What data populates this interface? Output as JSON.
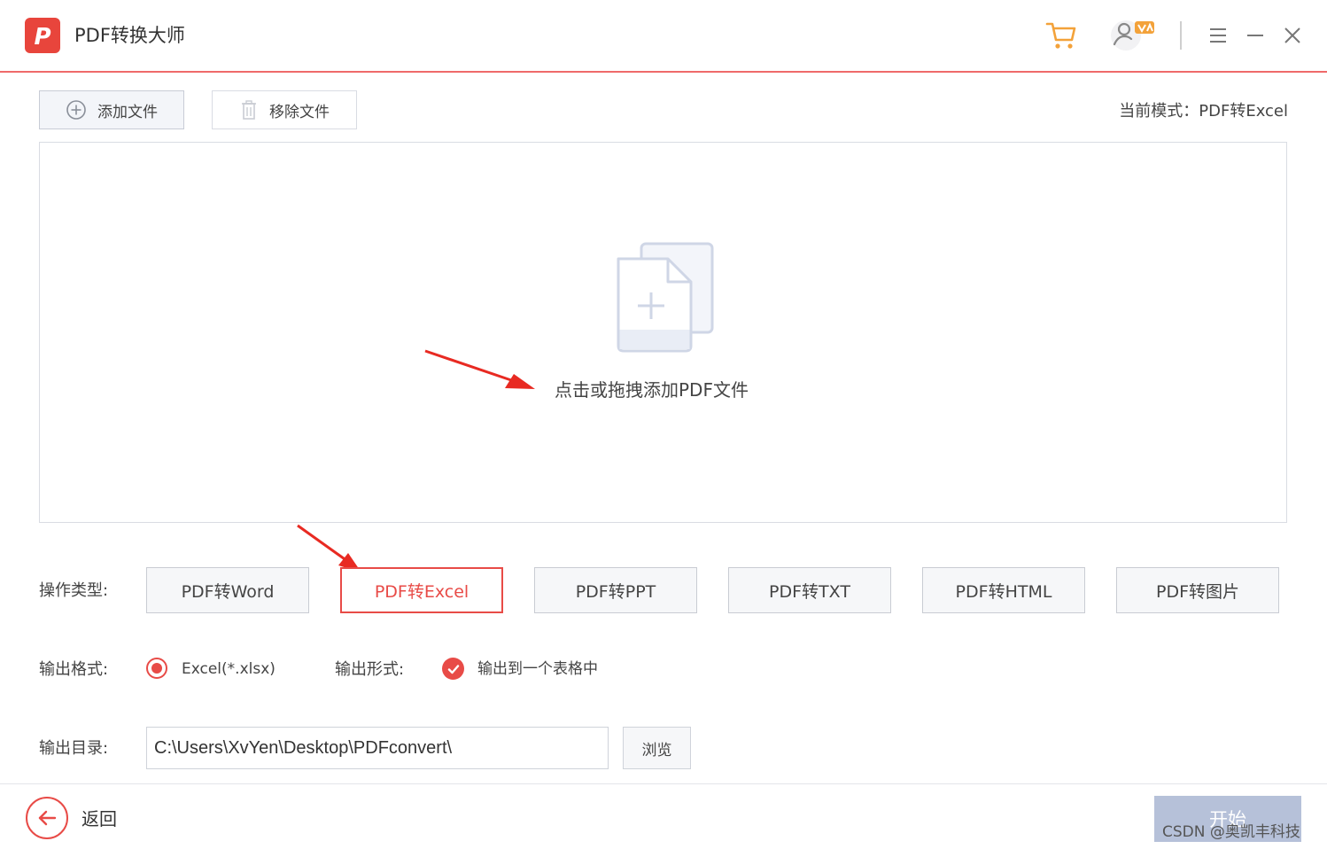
{
  "app": {
    "logo_letter": "P",
    "title": "PDF转换大师",
    "accent_color": "#e84b47",
    "icons": [
      "cart-icon",
      "user-vip-icon",
      "menu-icon",
      "minimize-icon",
      "close-icon"
    ]
  },
  "toolbar": {
    "add_label": "添加文件",
    "remove_label": "移除文件",
    "mode_text": "当前模式：PDF转Excel"
  },
  "dropzone": {
    "hint": "点击或拖拽添加PDF文件",
    "icon": "add-file-icon"
  },
  "operation": {
    "label": "操作类型:",
    "options": [
      "PDF转Word",
      "PDF转Excel",
      "PDF转PPT",
      "PDF转TXT",
      "PDF转HTML",
      "PDF转图片"
    ],
    "selected": "PDF转Excel"
  },
  "output_format": {
    "label": "输出格式:",
    "option": "Excel(*.xlsx)"
  },
  "output_form": {
    "label": "输出形式:",
    "option": "输出到一个表格中"
  },
  "output_dir": {
    "label": "输出目录:",
    "path": "C:\\Users\\XvYen\\Desktop\\PDFconvert\\",
    "browse_label": "浏览"
  },
  "footer": {
    "back_label": "返回",
    "start_label": "开始",
    "watermark": "CSDN @奥凯丰科技"
  }
}
